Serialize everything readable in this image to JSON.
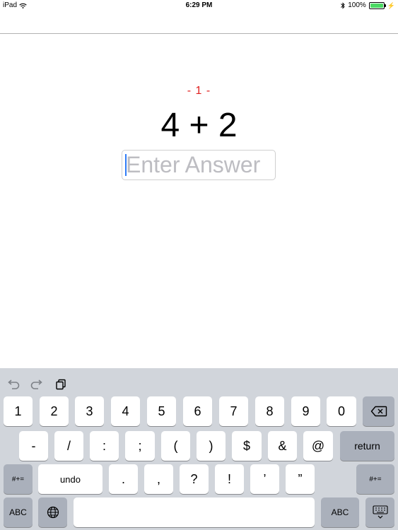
{
  "status_bar": {
    "device": "iPad",
    "time": "6:29 PM",
    "battery_percent": "100%"
  },
  "quiz": {
    "counter": "- 1 -",
    "question": "4 + 2",
    "answer_value": "",
    "answer_placeholder": "Enter Answer"
  },
  "keyboard": {
    "row1": [
      "1",
      "2",
      "3",
      "4",
      "5",
      "6",
      "7",
      "8",
      "9",
      "0"
    ],
    "row2": [
      "-",
      "/",
      ":",
      ";",
      "(",
      ")",
      "$",
      "&",
      "@"
    ],
    "return_label": "return",
    "row3_left": "#+=",
    "row3": [
      "undo",
      ".",
      ",",
      "?",
      "!",
      "’",
      "”"
    ],
    "row3_right": "#+=",
    "abc_left": "ABC",
    "abc_right": "ABC"
  },
  "colors": {
    "counter": "#e0201f",
    "keyboard_bg": "#d1d5db",
    "battery_fill": "#4cd964"
  },
  "icons": {
    "undo": "undo-arrow-icon",
    "redo": "redo-arrow-icon",
    "paste": "clipboard-icon",
    "delete": "backspace-icon",
    "globe": "globe-icon",
    "dismiss": "keyboard-dismiss-icon"
  }
}
